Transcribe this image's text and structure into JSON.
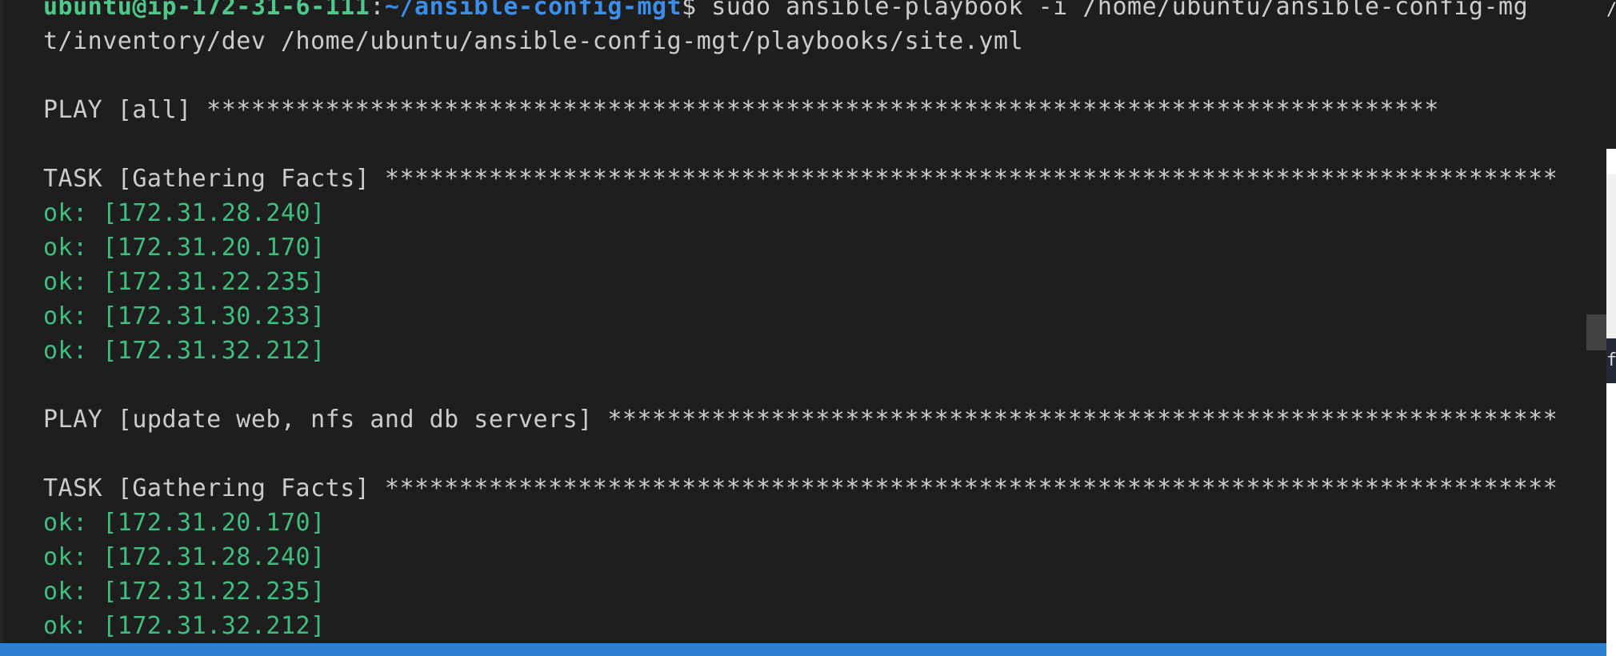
{
  "terminal": {
    "prompt_user": "ubuntu@ip-172-31-6-111",
    "prompt_sep": ":",
    "prompt_path": "~/ansible-config-mgt",
    "prompt_symbol": "$",
    "command_line1": " sudo ansible-playbook -i /home/ubuntu/ansible-config-mg",
    "command_line2": "t/inventory/dev /home/ubuntu/ansible-config-mgt/playbooks/site.yml",
    "play1": "PLAY [all] ***********************************************************************************",
    "task1": "TASK [Gathering Facts] *******************************************************************************",
    "task1_results": [
      "ok: [172.31.28.240]",
      "ok: [172.31.20.170]",
      "ok: [172.31.22.235]",
      "ok: [172.31.30.233]",
      "ok: [172.31.32.212]"
    ],
    "play2": "PLAY [update web, nfs and db servers] ****************************************************************",
    "task2": "TASK [Gathering Facts] *******************************************************************************",
    "task2_results": [
      "ok: [172.31.20.170]",
      "ok: [172.31.28.240]",
      "ok: [172.31.22.235]",
      "ok: [172.31.32.212]"
    ]
  },
  "side_panel": {
    "top_fragment": "/s",
    "mid_fragment": "f"
  },
  "colors": {
    "background": "#1e1e1e",
    "text": "#cccccc",
    "ok": "#3fbf7f",
    "user": "#4fc98a",
    "path": "#3b8eea",
    "statusbar": "#2f7fd1"
  }
}
